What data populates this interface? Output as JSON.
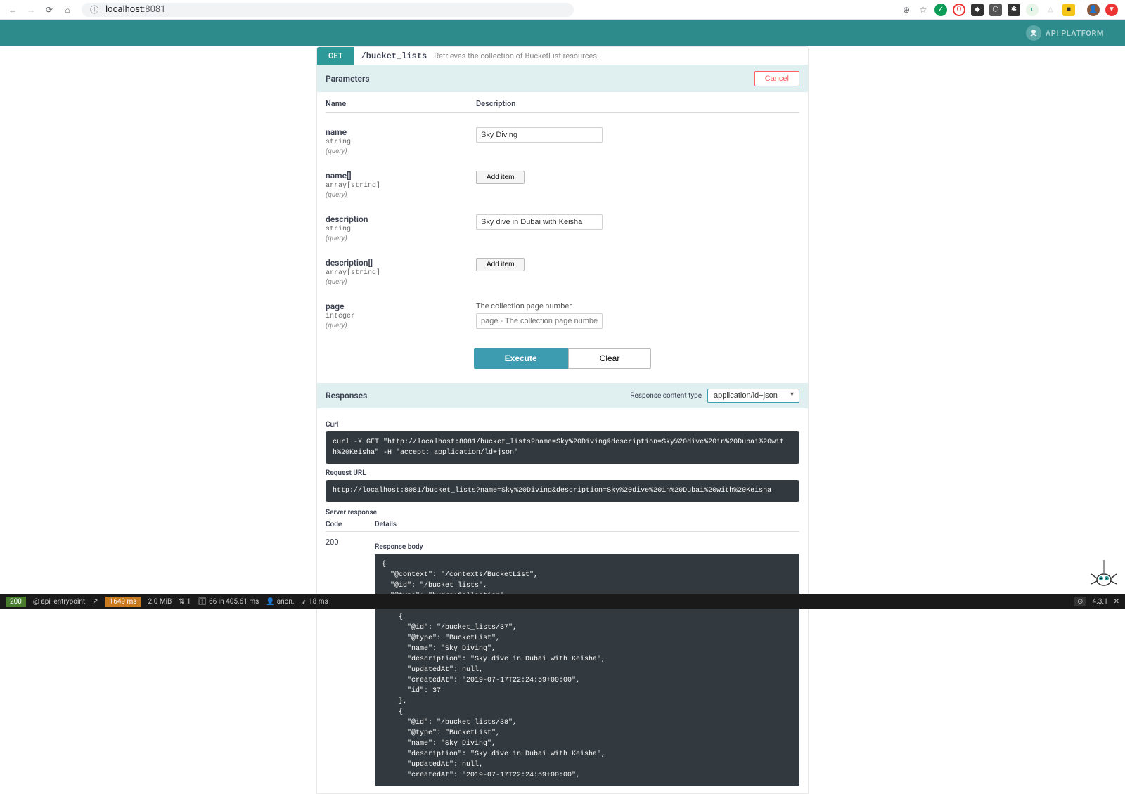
{
  "browser": {
    "url_host": "localhost",
    "url_port": ":8081"
  },
  "header": {
    "brand": "API PLATFORM"
  },
  "operation": {
    "method": "GET",
    "path": "/bucket_lists",
    "summary": "Retrieves the collection of BucketList resources."
  },
  "sections": {
    "parameters_title": "Parameters",
    "cancel": "Cancel",
    "name_col": "Name",
    "desc_col": "Description",
    "responses_title": "Responses",
    "content_type_label": "Response content type",
    "content_type_value": "application/ld+json",
    "curl_label": "Curl",
    "request_url_label": "Request URL",
    "server_response_label": "Server response",
    "code_label": "Code",
    "details_label": "Details",
    "response_body_label": "Response body"
  },
  "parameters": [
    {
      "name": "name",
      "type": "string",
      "loc": "(query)",
      "input_type": "text",
      "value": "Sky Diving",
      "placeholder": ""
    },
    {
      "name": "name[]",
      "type": "array[string]",
      "loc": "(query)",
      "input_type": "add",
      "button": "Add item"
    },
    {
      "name": "description",
      "type": "string",
      "loc": "(query)",
      "input_type": "text",
      "value": "Sky dive in Dubai with Keisha",
      "placeholder": ""
    },
    {
      "name": "description[]",
      "type": "array[string]",
      "loc": "(query)",
      "input_type": "add",
      "button": "Add item"
    },
    {
      "name": "page",
      "type": "integer",
      "loc": "(query)",
      "input_type": "text",
      "label": "The collection page number",
      "value": "",
      "placeholder": "page - The collection page number"
    }
  ],
  "buttons": {
    "execute": "Execute",
    "clear": "Clear"
  },
  "response": {
    "curl": "curl -X GET \"http://localhost:8081/bucket_lists?name=Sky%20Diving&description=Sky%20dive%20in%20Dubai%20with%20Keisha\" -H \"accept: application/ld+json\"",
    "request_url": "http://localhost:8081/bucket_lists?name=Sky%20Diving&description=Sky%20dive%20in%20Dubai%20with%20Keisha",
    "code": "200",
    "body": "{\n  \"@context\": \"/contexts/BucketList\",\n  \"@id\": \"/bucket_lists\",\n  \"@type\": \"hydra:Collection\",\n  \"hydra:member\": [\n    {\n      \"@id\": \"/bucket_lists/37\",\n      \"@type\": \"BucketList\",\n      \"name\": \"Sky Diving\",\n      \"description\": \"Sky dive in Dubai with Keisha\",\n      \"updatedAt\": null,\n      \"createdAt\": \"2019-07-17T22:24:59+00:00\",\n      \"id\": 37\n    },\n    {\n      \"@id\": \"/bucket_lists/38\",\n      \"@type\": \"BucketList\",\n      \"name\": \"Sky Diving\",\n      \"description\": \"Sky dive in Dubai with Keisha\",\n      \"updatedAt\": null,\n      \"createdAt\": \"2019-07-17T22:24:59+00:00\","
  },
  "status_bar": {
    "code": "200",
    "route": "@ api_entrypoint",
    "time": "1649 ms",
    "memory": "2.0 MiB",
    "ajax": "1",
    "db": "66 in 405.61 ms",
    "user": "anon.",
    "render": "18 ms",
    "version": "4.3.1"
  },
  "chart_data": null
}
